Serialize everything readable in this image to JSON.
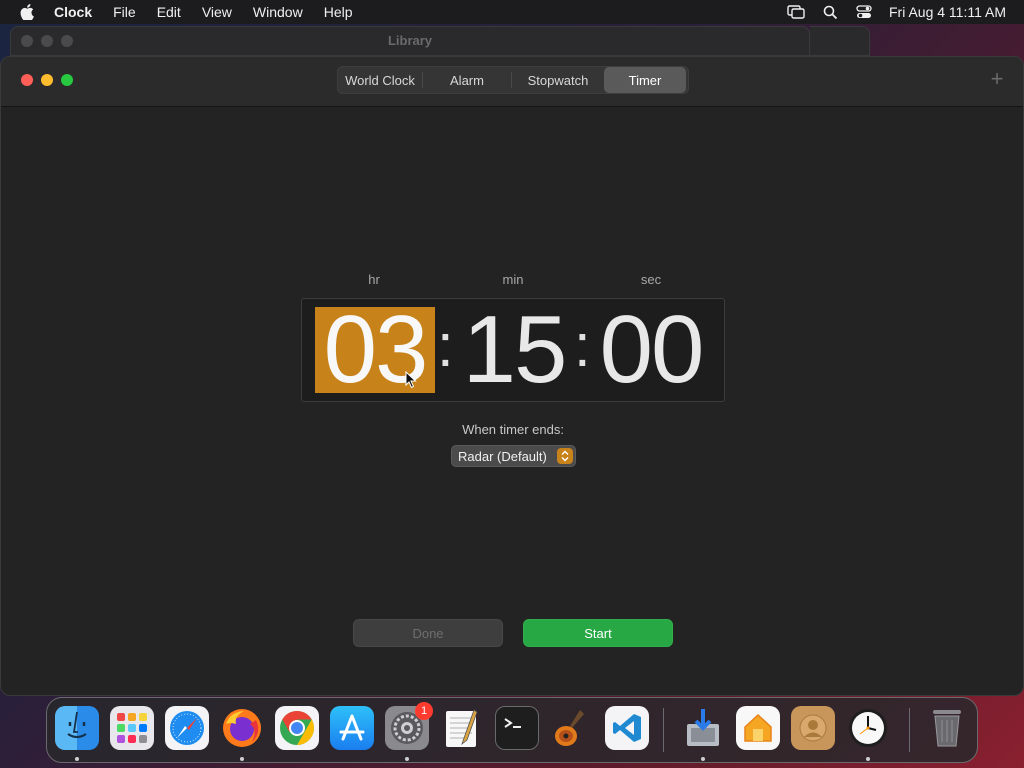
{
  "menubar": {
    "app_name": "Clock",
    "items": [
      "File",
      "Edit",
      "View",
      "Window",
      "Help"
    ],
    "datetime": "Fri Aug 4  11:11 AM"
  },
  "background_window": {
    "title": "Library"
  },
  "toolbar": {
    "tabs": [
      {
        "label": "World Clock",
        "selected": false
      },
      {
        "label": "Alarm",
        "selected": false
      },
      {
        "label": "Stopwatch",
        "selected": false
      },
      {
        "label": "Timer",
        "selected": true
      }
    ],
    "add_label": "+"
  },
  "timer": {
    "hr_label": "hr",
    "min_label": "min",
    "sec_label": "sec",
    "hours": "03",
    "minutes": "15",
    "seconds": "00",
    "separator": ":",
    "selected_field": "hours",
    "ends_label": "When timer ends:",
    "sound_value": "Radar (Default)"
  },
  "buttons": {
    "done_label": "Done",
    "start_label": "Start"
  },
  "dock": {
    "apps": [
      {
        "name": "finder-icon",
        "running": true
      },
      {
        "name": "launchpad-icon",
        "running": false
      },
      {
        "name": "safari-icon",
        "running": false
      },
      {
        "name": "firefox-icon",
        "running": true
      },
      {
        "name": "chrome-icon",
        "running": false
      },
      {
        "name": "app-store-icon",
        "running": false
      },
      {
        "name": "system-settings-icon",
        "running": true,
        "badge": "1"
      },
      {
        "name": "textedit-icon",
        "running": false
      },
      {
        "name": "terminal-icon",
        "running": false
      },
      {
        "name": "garageband-icon",
        "running": false
      },
      {
        "name": "vscode-icon",
        "running": false
      },
      {
        "name": "installer-icon",
        "running": true
      },
      {
        "name": "home-icon",
        "running": false
      },
      {
        "name": "contacts-icon",
        "running": false
      },
      {
        "name": "clock-icon",
        "running": true
      },
      {
        "name": "trash-icon",
        "running": false
      }
    ]
  },
  "colors": {
    "accent": "#c8821a",
    "start_green": "#28a745",
    "window_bg": "#232323"
  }
}
